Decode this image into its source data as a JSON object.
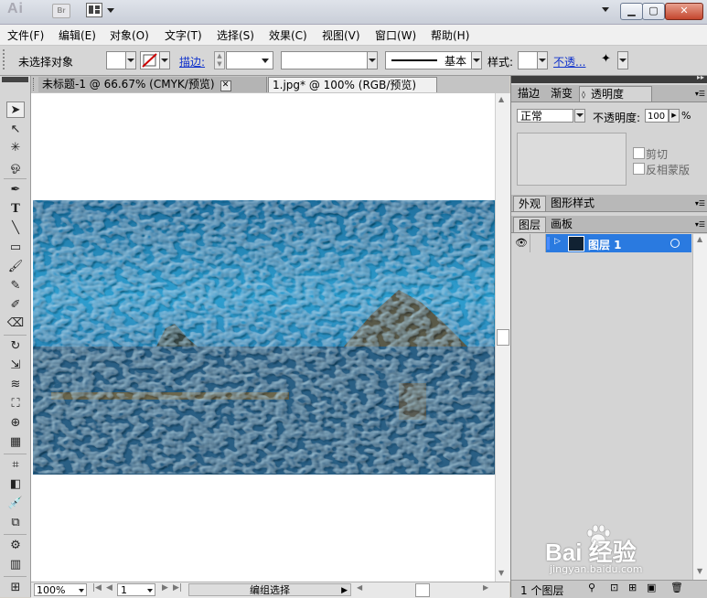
{
  "titlebar": {
    "app_logo": "Ai",
    "bridge_label": "Br",
    "window_controls": {
      "minimize": "▁",
      "maximize": "▢",
      "close": "✕"
    }
  },
  "menu": [
    "文件(F)",
    "编辑(E)",
    "对象(O)",
    "文字(T)",
    "选择(S)",
    "效果(C)",
    "视图(V)",
    "窗口(W)",
    "帮助(H)"
  ],
  "control_bar": {
    "selection_status": "未选择对象",
    "stroke_label": "描边:",
    "stroke_style": "基本",
    "style_label": "样式:",
    "opacity_link": "不透..."
  },
  "documents": {
    "tabs": [
      {
        "label": "未标题-1 @ 66.67% (CMYK/预览)",
        "close": "✕"
      },
      {
        "label": "1.jpg* @ 100% (RGB/预览)",
        "close": "✕"
      }
    ],
    "active_tab": 1
  },
  "status_bar": {
    "zoom": "100%",
    "page": "1",
    "tool_status": "编组选择"
  },
  "panels": {
    "top_tabs": [
      "描边",
      "渐变",
      "透明度"
    ],
    "transparency": {
      "blend_mode": "正常",
      "opacity_label": "不透明度:",
      "opacity_value": "100",
      "opacity_unit": "%",
      "clip_label": "剪切",
      "invert_mask_label": "反相蒙版"
    },
    "middle_tabs": [
      "外观",
      "图形样式"
    ],
    "layer_tabs": [
      "图层",
      "画板"
    ],
    "layers": [
      {
        "name": "图层 1",
        "visible": true
      }
    ],
    "layers_count": "1 个图层"
  },
  "watermark": {
    "brand": "Bai 经验",
    "url": "jingyan.baidu.com"
  },
  "colors": {
    "accent": "#2a7ae0",
    "artwork_main": "#2b8fbe"
  }
}
